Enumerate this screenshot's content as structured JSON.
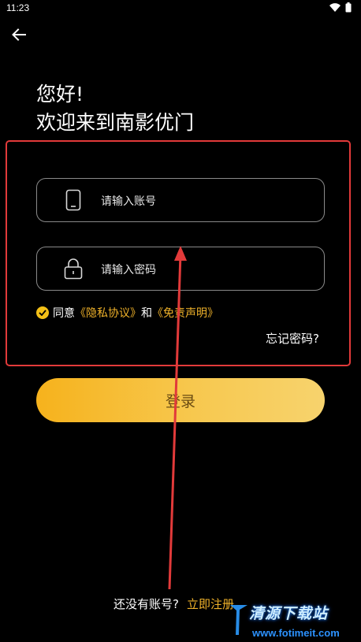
{
  "status_bar": {
    "time": "11:23",
    "icons": [
      "wifi-icon",
      "battery-icon"
    ]
  },
  "header": {
    "back_icon": "arrow-left-icon"
  },
  "greeting": {
    "line1": "您好!",
    "line2": "欢迎来到南影优门"
  },
  "form": {
    "account": {
      "placeholder": "请输入账号",
      "icon": "phone-icon"
    },
    "password": {
      "placeholder": "请输入密码",
      "icon": "lock-icon"
    },
    "agreement": {
      "prefix": "同意",
      "privacy": "《隐私协议》",
      "and": "和",
      "disclaimer": "《免责声明》",
      "checked": true
    },
    "forgot_password": "忘记密码?",
    "login_label": "登录"
  },
  "footer": {
    "no_account": "还没有账号?",
    "register": "立即注册"
  },
  "watermark": {
    "title": "清源下载站",
    "url": "www.fotimeit.com"
  },
  "colors": {
    "accent": "#f0b22a",
    "button_start": "#f6b21c",
    "button_end": "#f7d36d",
    "annotation": "#e23a3a"
  }
}
